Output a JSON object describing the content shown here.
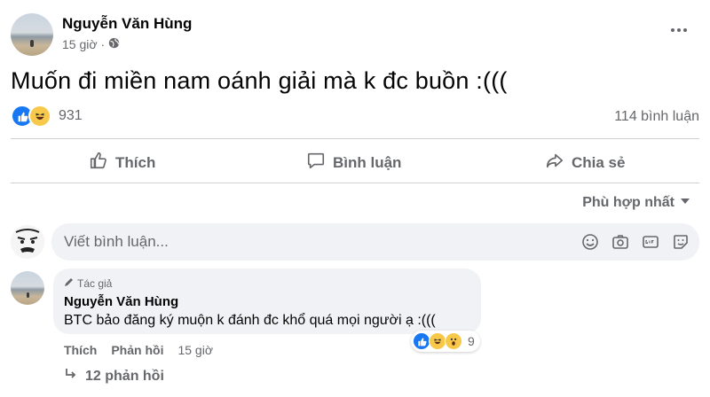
{
  "post": {
    "author_name": "Nguyễn Văn Hùng",
    "time": "15 giờ",
    "separator": "·",
    "text": "Muốn đi miền nam oánh giải mà k đc buồn :(((",
    "reaction_count": "931",
    "comment_count": "114 bình luận"
  },
  "actions": {
    "like_label": "Thích",
    "comment_label": "Bình luận",
    "share_label": "Chia sẻ"
  },
  "sort": {
    "label": "Phù hợp nhất"
  },
  "composer": {
    "placeholder": "Viết bình luận..."
  },
  "comment": {
    "author_tag": "Tác giả",
    "author_name": "Nguyễn Văn Hùng",
    "text": "BTC bảo đăng ký muộn k đánh đc khổ quá mọi người ạ :(((",
    "reaction_count": "9",
    "like_label": "Thích",
    "reply_label": "Phản hồi",
    "time": "15 giờ",
    "replies_label": "12 phản hồi"
  },
  "colors": {
    "like_blue": "#1877f2",
    "haha_yellow": "#f7c84a",
    "meta_gray": "#65676b",
    "bubble_bg": "#f0f2f5"
  }
}
